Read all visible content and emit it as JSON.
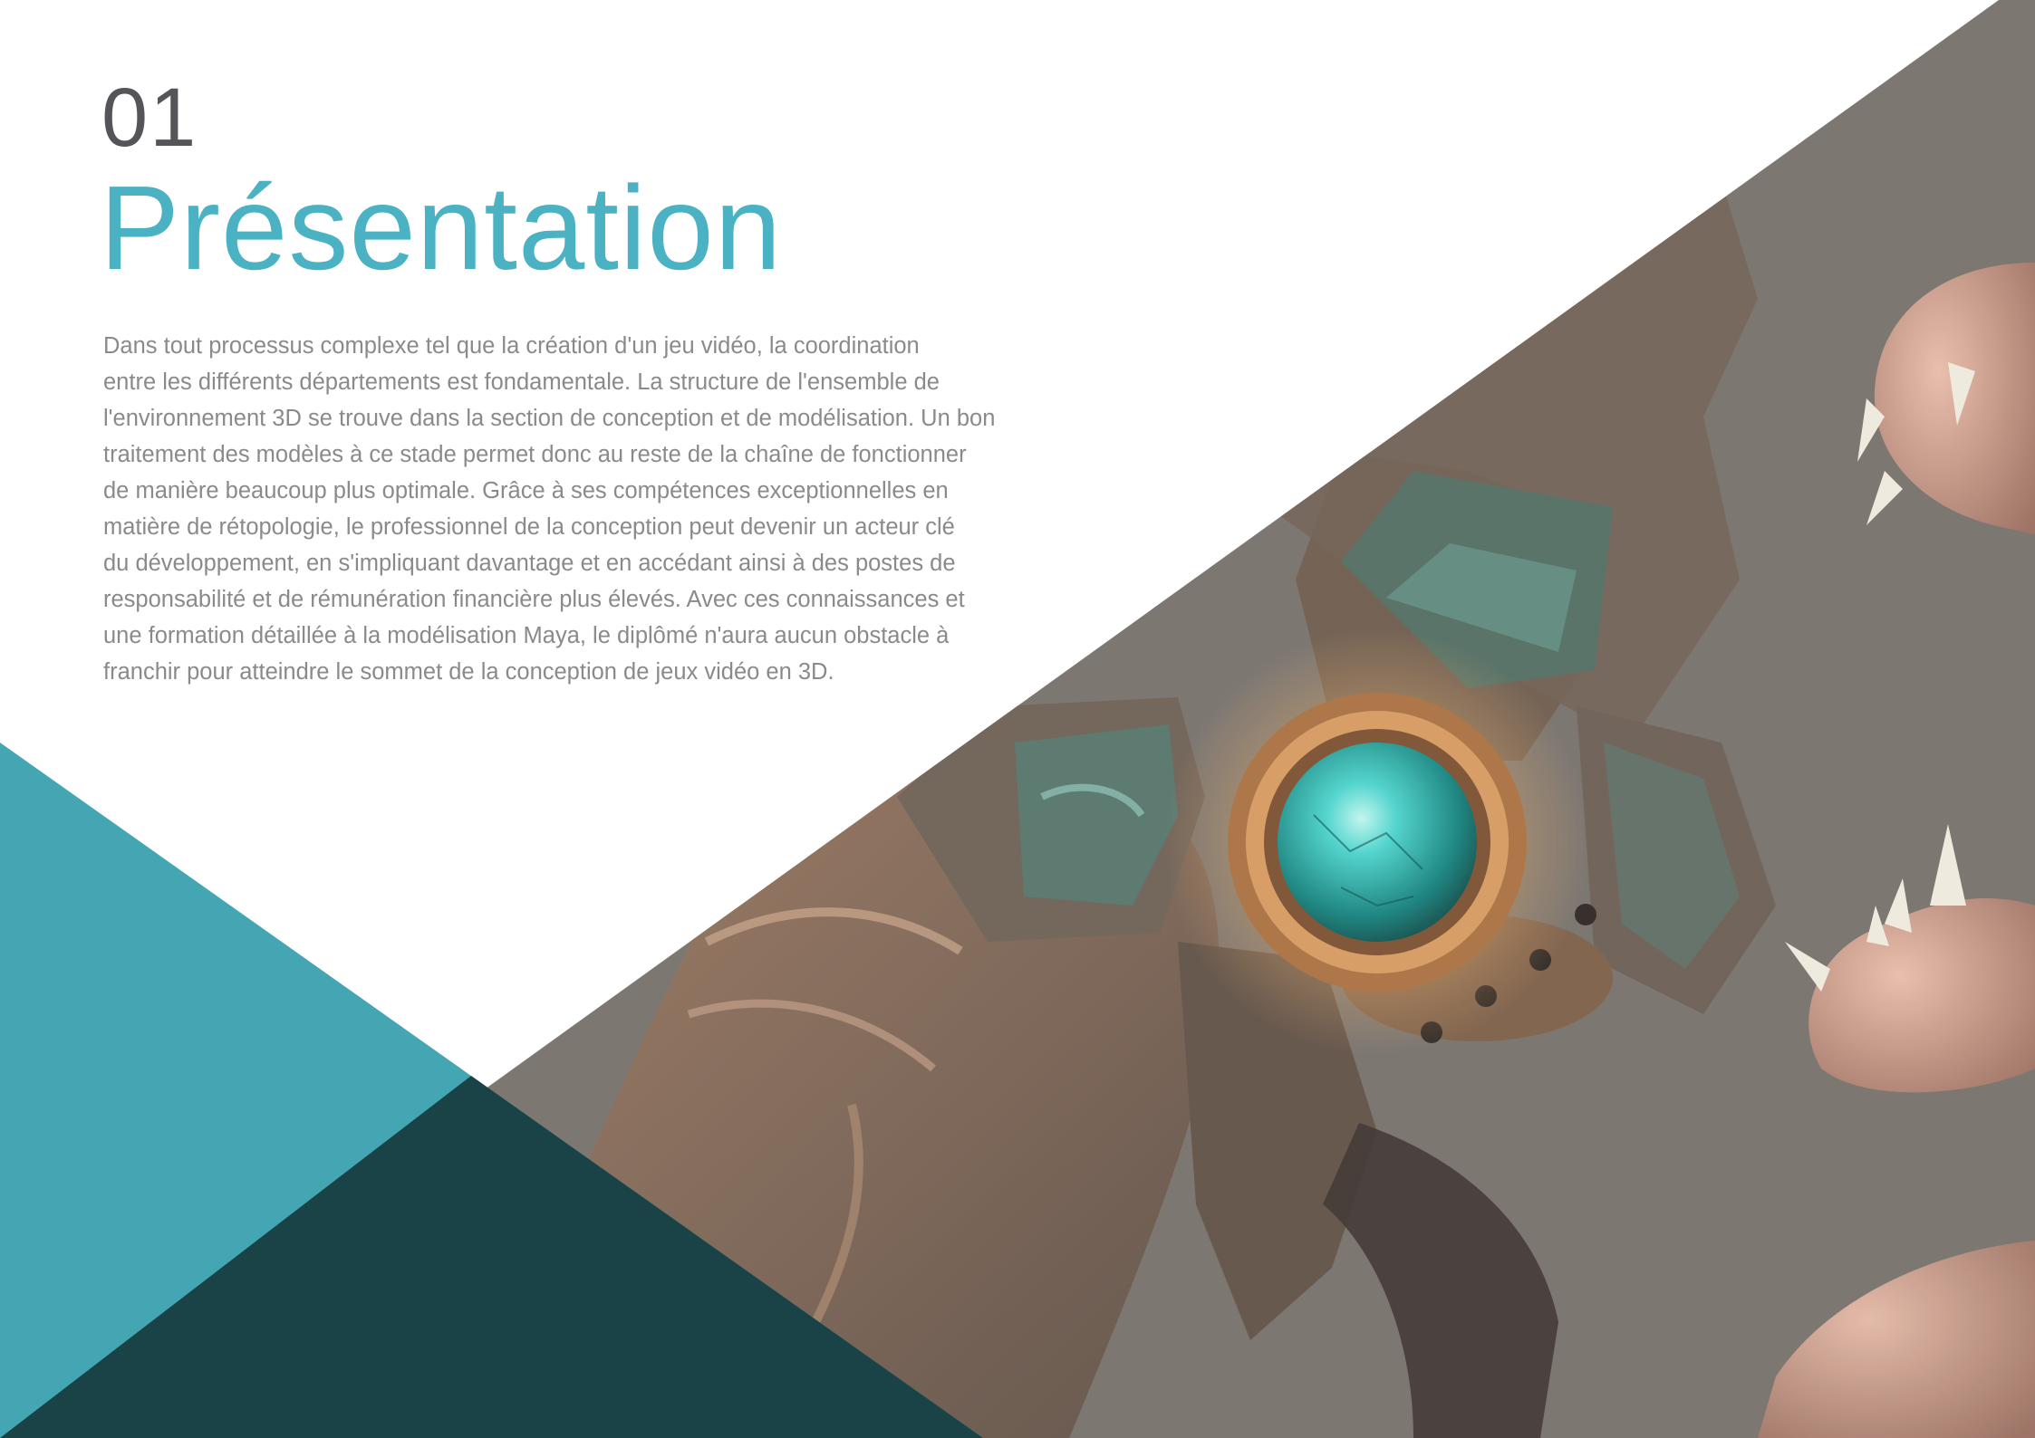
{
  "colors": {
    "accent": "#4ab2c2",
    "number": "#555559",
    "text": "#8a8a8a",
    "teal_panel": "#44a6b2",
    "dark_teal": "#173b3e",
    "photo_base": "#76706b"
  },
  "header": {
    "number": "01",
    "title": "Présentation"
  },
  "body": {
    "lines": [
      "Dans tout processus complexe tel que la création d'un jeu vidéo, la coordination",
      "entre les différents départements est fondamentale. La structure de l'ensemble de",
      "l'environnement 3D se trouve dans la section de conception et de modélisation. Un bon",
      "traitement des modèles à ce stade permet donc au reste de la chaîne de fonctionner",
      "de manière beaucoup plus optimale. Grâce à ses compétences exceptionnelles en",
      "matière de rétopologie, le professionnel de la conception peut devenir un acteur clé",
      "du développement, en s'impliquant davantage et en accédant ainsi à des postes de",
      "responsabilité et de rémunération financière plus élevés. Avec ces connaissances et",
      "une formation détaillée à la modélisation Maya, le diplômé n'aura aucun obstacle à",
      "franchir pour atteindre le sommet de la conception de jeux vidéo en 3D."
    ]
  },
  "image": {
    "subject": "3D game asset render: bronze ornamental piece with glowing turquoise orb and creature heads"
  }
}
